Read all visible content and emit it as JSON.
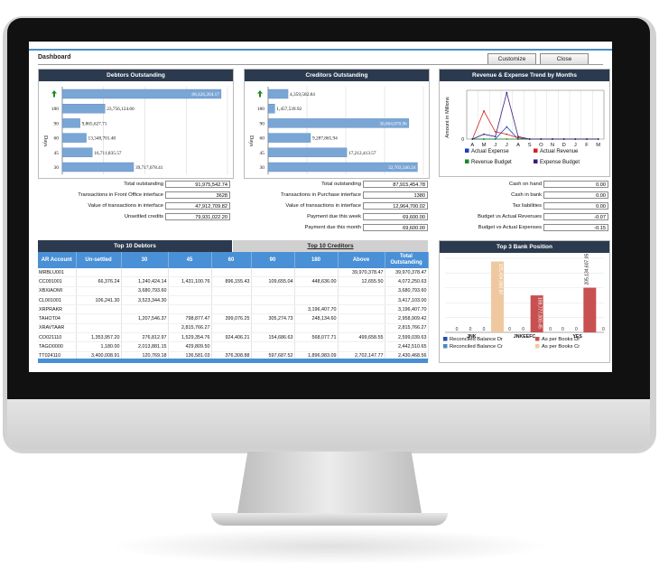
{
  "dashboard": {
    "title": "Dashboard",
    "customize_label": "Customize",
    "close_label": "Close"
  },
  "debtors": {
    "title": "Debtors Outstanding",
    "axis_label": "Days",
    "bars": [
      {
        "category": "↑",
        "value": 88426204.17,
        "label": "88,426,204.17"
      },
      {
        "category": "180",
        "value": 23756124.6,
        "label": "23,756,124.60"
      },
      {
        "category": "90",
        "value": 9865627.71,
        "label": "9,865,627.71"
      },
      {
        "category": "60",
        "value": 13348701.48,
        "label": "13,348,701.48"
      },
      {
        "category": "45",
        "value": 16711835.57,
        "label": "16,711,835.57"
      },
      {
        "category": "30",
        "value": 39717078.41,
        "label": "39,717,078.41"
      }
    ],
    "summary": [
      {
        "label": "Total outstanding",
        "value": "91,975,542.74"
      },
      {
        "label": "Transactions in Front Office interface",
        "value": "3628"
      },
      {
        "label": "Value of transactions in interface",
        "value": "47,912,709.82"
      },
      {
        "label": "Unsettled credits",
        "value": "79,931,022.20"
      }
    ]
  },
  "creditors": {
    "title": "Creditors Outstanding",
    "axis_label": "Days",
    "bars": [
      {
        "category": "↑",
        "value": 4359582.84,
        "label": "4,359,582.84"
      },
      {
        "category": "180",
        "value": 1457539.92,
        "label": "1,457,539.92"
      },
      {
        "category": "90",
        "value": 30804870.96,
        "label": "30,804,870.96"
      },
      {
        "category": "60",
        "value": 9287865.94,
        "label": "9,287,865.94"
      },
      {
        "category": "45",
        "value": 17212413.57,
        "label": "17,212,413.57"
      },
      {
        "category": "30",
        "value": 32703346.24,
        "label": "32,703,346.24"
      }
    ],
    "summary": [
      {
        "label": "Total outstanding",
        "value": "87,915,454.78"
      },
      {
        "label": "Transactions in Purchase interface",
        "value": "1380"
      },
      {
        "label": "Value of transactions in interface",
        "value": "12,964,700.02"
      },
      {
        "label": "Payment due this week",
        "value": "69,600.00"
      },
      {
        "label": "Payment due this month",
        "value": "69,600.00"
      }
    ]
  },
  "trend": {
    "title": "Revenue & Expense Trend by Months",
    "ylabel": "Amount in Millions",
    "y_tick": "0",
    "months": [
      "A",
      "M",
      "J",
      "J",
      "A",
      "S",
      "O",
      "N",
      "D",
      "J",
      "F",
      "M"
    ],
    "series": [
      {
        "name": "Actual Expense",
        "color": "#1a3fc4",
        "values": [
          0,
          0,
          0,
          1,
          0,
          0,
          0,
          0,
          0,
          0,
          0,
          0
        ]
      },
      {
        "name": "Actual Revenue",
        "color": "#d22222",
        "values": [
          0,
          2.3,
          0.6,
          0.4,
          0.1,
          0,
          0,
          0,
          0,
          0,
          0,
          0
        ]
      },
      {
        "name": "Revenue Budget",
        "color": "#1a8a2a",
        "values": [
          0,
          0,
          0,
          0,
          0,
          0,
          0,
          0,
          0,
          0,
          0,
          0
        ]
      },
      {
        "name": "Expense Budget",
        "color": "#3a1a7a",
        "values": [
          0,
          0.4,
          0.2,
          3.8,
          0.2,
          0,
          0,
          0,
          0,
          0,
          0,
          0
        ]
      }
    ],
    "summary": [
      {
        "label": "Cash on hand",
        "value": "0.00"
      },
      {
        "label": "Cash in bank",
        "value": "0.00"
      },
      {
        "label": "Tax liabilities",
        "value": "0.00"
      },
      {
        "label": "Budget vs Actual Revenues",
        "value": "-0.07"
      },
      {
        "label": "Budget vs Actual Expenses",
        "value": "-0.15"
      }
    ]
  },
  "top10": {
    "tab_debtors": "Top 10 Debtors",
    "tab_creditors": "Top 10 Creditors",
    "headers": [
      "AR Account",
      "Un-settled",
      "30",
      "45",
      "60",
      "90",
      "180",
      "Above",
      "Total Outstanding"
    ],
    "rows": [
      [
        "MRBLU001",
        "",
        "",
        "",
        "",
        "",
        "",
        "39,970,378.47",
        "39,970,378.47"
      ],
      [
        "CC091001",
        "66,376.24",
        "1,240,424.14",
        "1,431,100.76",
        "896,155.43",
        "109,655.04",
        "448,636.00",
        "12,655.50",
        "4,072,250.63"
      ],
      [
        "XBXIAOMI",
        "",
        "3,680,793.60",
        "",
        "",
        "",
        "",
        "",
        "3,680,793.60"
      ],
      [
        "CL001001",
        "106,241.30",
        "3,523,344.30",
        "",
        "",
        "",
        "",
        "",
        "3,417,103.00"
      ],
      [
        "XRPRAKR",
        "",
        "",
        "",
        "",
        "",
        "3,196,407.70",
        "",
        "3,196,407.70"
      ],
      [
        "TAHOT04",
        "",
        "1,207,546.37",
        "798,877.47",
        "399,076.25",
        "305,274.73",
        "248,134.60",
        "",
        "2,958,909.42"
      ],
      [
        "XRAVTAAR",
        "",
        "",
        "2,815,766.27",
        "",
        "",
        "",
        "",
        "2,815,766.27"
      ],
      [
        "CO021110",
        "1,353,957.20",
        "276,812.97",
        "1,529,354.76",
        "924,406.21",
        "154,686.63",
        "568,077.71",
        "499,658.55",
        "2,599,039.63"
      ],
      [
        "TAGO0000",
        "1,180.00",
        "2,013,881.15",
        "429,809.50",
        "",
        "",
        "",
        "",
        "2,442,510.65"
      ],
      [
        "TT024110",
        "3,400,008.91",
        "120,769.18",
        "136,581.03",
        "376,308.88",
        "597,687.52",
        "1,896,983.09",
        "2,702,147.77",
        "2,430,468.56"
      ]
    ]
  },
  "bank": {
    "title": "Top 3 Bank Position",
    "categories": [
      "JNK",
      "JNKEEFC",
      "YES"
    ],
    "series": [
      {
        "name": "Reconciled Balance Dr",
        "color": "#2050b0",
        "values": [
          0,
          0,
          0
        ]
      },
      {
        "name": "As per Books Dr",
        "color": "#c85050",
        "values": [
          0,
          169777000.45,
          205134607.05
        ]
      },
      {
        "name": "Reconciled Balance Cr",
        "color": "#4a8ac0",
        "values": [
          0,
          0,
          0
        ]
      },
      {
        "name": "As per Books Cr",
        "color": "#f0c8a0",
        "values": [
          325434060.87,
          0,
          0
        ]
      }
    ],
    "bar_labels": [
      "325,434,060.87",
      "169,777,000.45",
      "205,134,607.05"
    ],
    "zero_label": "0"
  }
}
